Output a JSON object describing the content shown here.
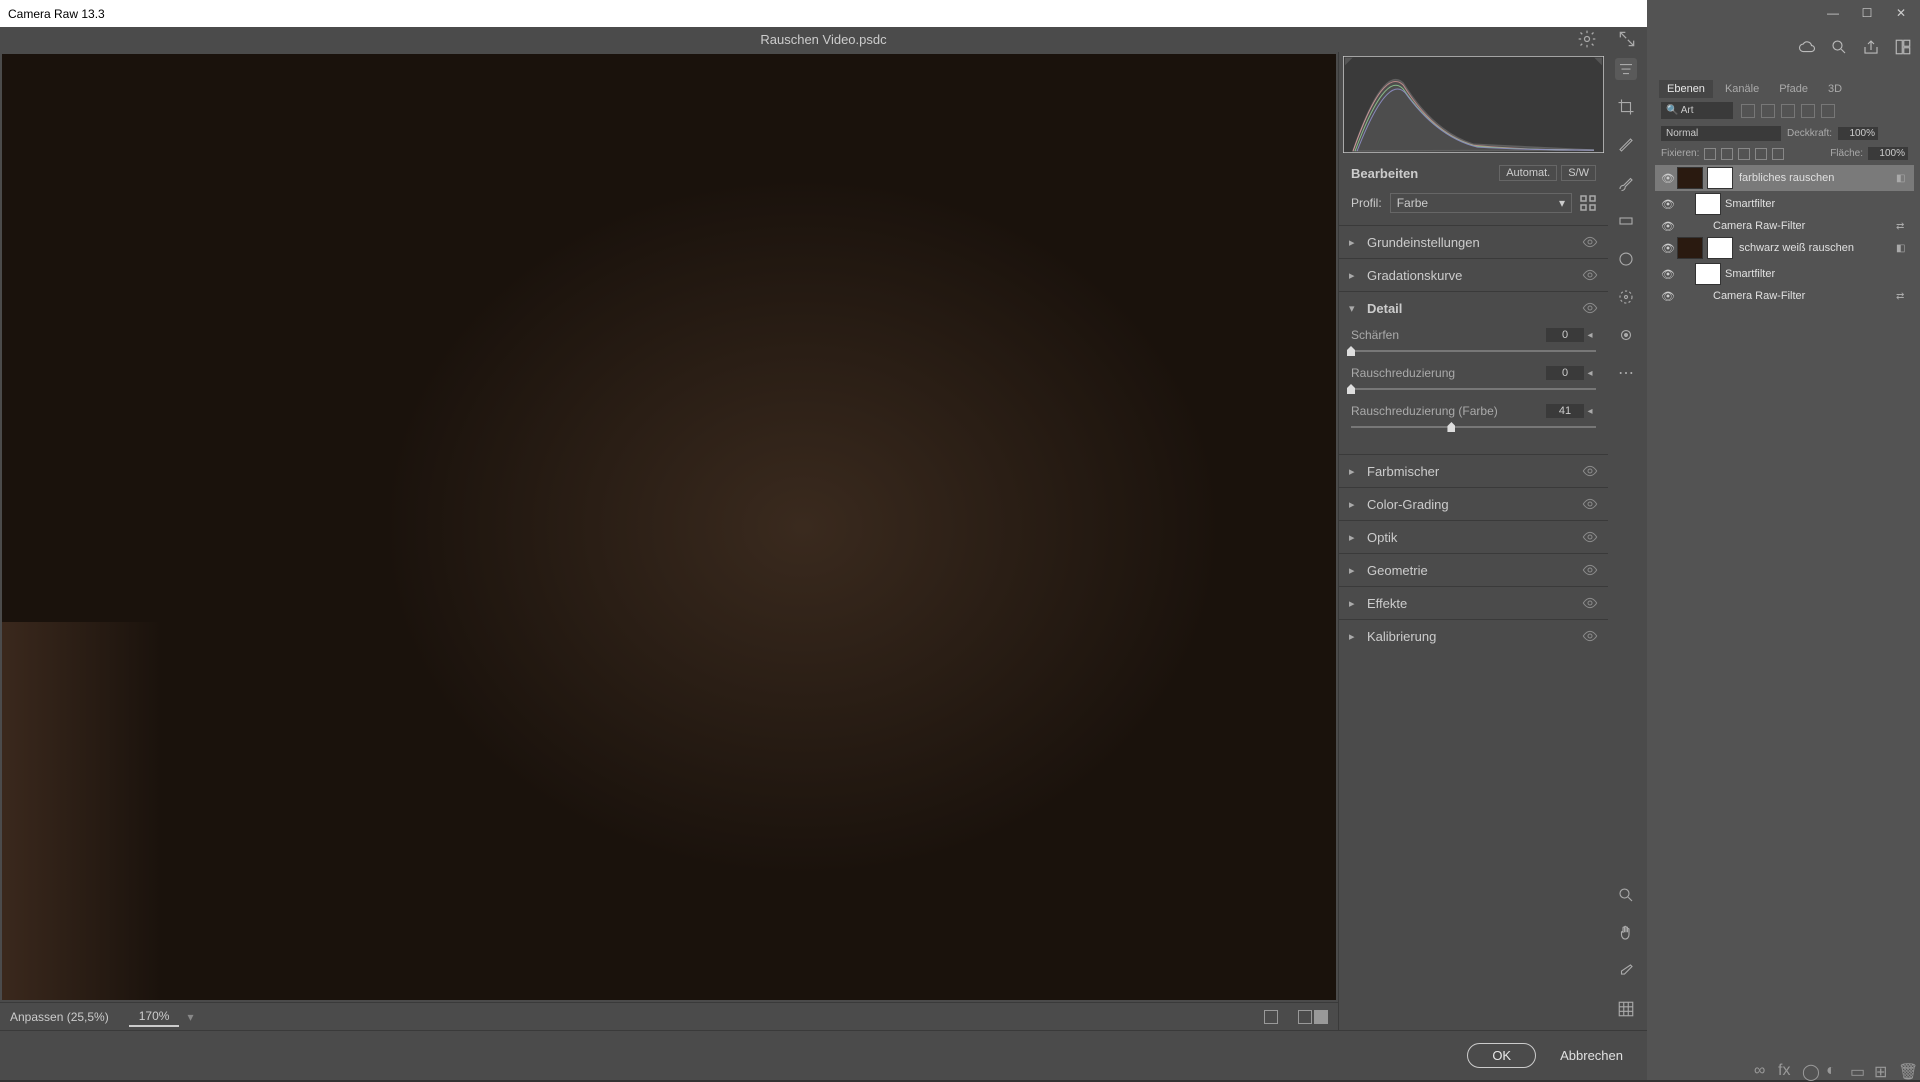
{
  "camera_raw": {
    "title": "Camera Raw 13.3",
    "filename": "Rauschen Video.psdc",
    "edit": {
      "heading": "Bearbeiten",
      "auto_btn": "Automat.",
      "bw_btn": "S/W",
      "profile_label": "Profil:",
      "profile_value": "Farbe"
    },
    "sections": {
      "basic": "Grundeinstellungen",
      "curve": "Gradationskurve",
      "detail": "Detail",
      "mixer": "Farbmischer",
      "grading": "Color-Grading",
      "optics": "Optik",
      "geometry": "Geometrie",
      "effects": "Effekte",
      "calibration": "Kalibrierung"
    },
    "detail_sliders": {
      "sharpen": {
        "label": "Schärfen",
        "value": "0",
        "pos": 0
      },
      "noise": {
        "label": "Rauschreduzierung",
        "value": "0",
        "pos": 0
      },
      "color_noise": {
        "label": "Rauschreduzierung (Farbe)",
        "value": "41",
        "pos": 41
      }
    },
    "status": {
      "fit": "Anpassen (25,5%)",
      "zoom": "170%"
    },
    "footer": {
      "ok": "OK",
      "cancel": "Abbrechen"
    }
  },
  "ps": {
    "tabs": {
      "layers": "Ebenen",
      "channels": "Kanäle",
      "paths": "Pfade",
      "threeD": "3D"
    },
    "filter_kind": "Art",
    "blend_mode": "Normal",
    "opacity_label": "Deckkraft:",
    "opacity_value": "100%",
    "lock_label": "Fixieren:",
    "fill_label": "Fläche:",
    "fill_value": "100%",
    "layers": {
      "l1": "farbliches rauschen",
      "sf": "Smartfilter",
      "crf": "Camera Raw-Filter",
      "l2": "schwarz weiß rauschen"
    }
  }
}
